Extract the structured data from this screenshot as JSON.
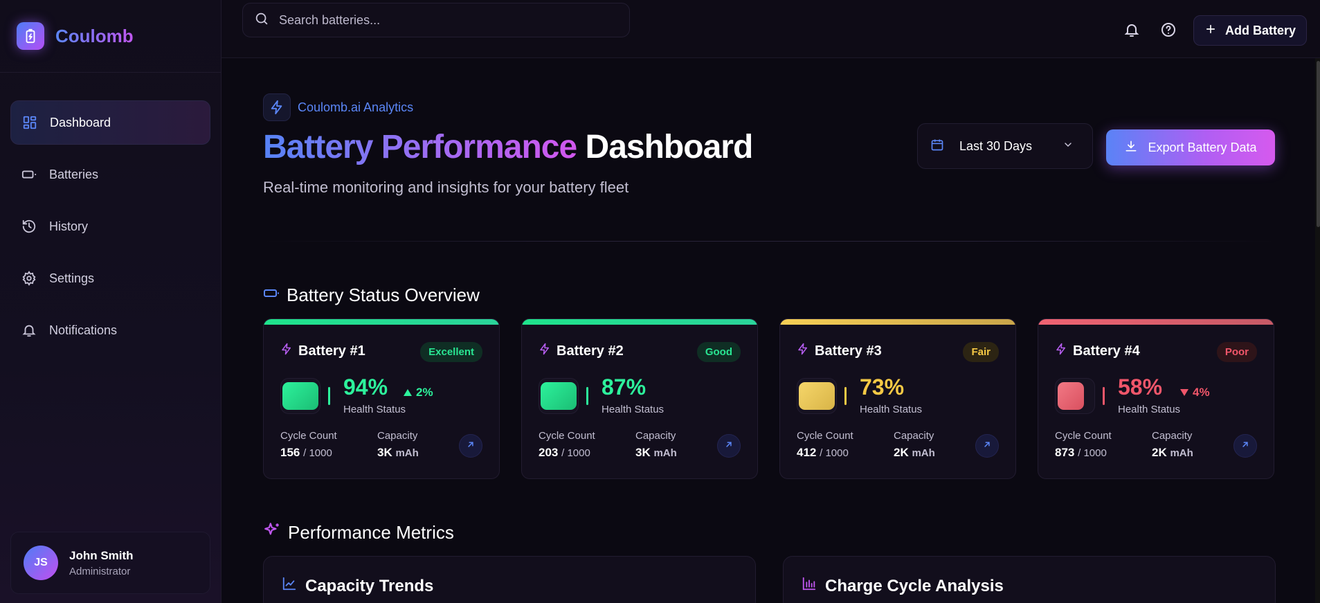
{
  "brand": {
    "name": "Coulomb"
  },
  "search": {
    "placeholder": "Search batteries..."
  },
  "topbar": {
    "add_label": "Add Battery"
  },
  "nav": [
    {
      "label": "Dashboard",
      "icon": "dashboard-icon",
      "active": true
    },
    {
      "label": "Batteries",
      "icon": "battery-icon"
    },
    {
      "label": "History",
      "icon": "history-icon"
    },
    {
      "label": "Settings",
      "icon": "gear-icon"
    },
    {
      "label": "Notifications",
      "icon": "bell-icon"
    }
  ],
  "user": {
    "initials": "JS",
    "name": "John Smith",
    "role": "Administrator"
  },
  "header": {
    "pill": "Coulomb.ai Analytics",
    "title_gradient": "Battery Performance",
    "title_plain": "Dashboard",
    "subtitle": "Real-time monitoring and insights for your battery fleet",
    "range": "Last 30 Days",
    "export_label": "Export Battery Data"
  },
  "status_section": {
    "title": "Battery Status Overview"
  },
  "batteries": [
    {
      "name": "Battery #1",
      "badge": "Excellent",
      "health": "94%",
      "delta": "2%",
      "delta_dir": "up",
      "health_label": "Health Status",
      "cycle_label": "Cycle Count",
      "cycle": "156",
      "cycle_max": "/ 1000",
      "capacity_label": "Capacity",
      "capacity": "3K",
      "capacity_unit": "mAh",
      "color": "#22e38a"
    },
    {
      "name": "Battery #2",
      "badge": "Good",
      "health": "87%",
      "delta": "",
      "delta_dir": "",
      "health_label": "Health Status",
      "cycle_label": "Cycle Count",
      "cycle": "203",
      "cycle_max": "/ 1000",
      "capacity_label": "Capacity",
      "capacity": "3K",
      "capacity_unit": "mAh",
      "color": "#22e38a"
    },
    {
      "name": "Battery #3",
      "badge": "Fair",
      "health": "73%",
      "delta": "",
      "delta_dir": "",
      "health_label": "Health Status",
      "cycle_label": "Cycle Count",
      "cycle": "412",
      "cycle_max": "/ 1000",
      "capacity_label": "Capacity",
      "capacity": "2K",
      "capacity_unit": "mAh",
      "color": "#f2c94c"
    },
    {
      "name": "Battery #4",
      "badge": "Poor",
      "health": "58%",
      "delta": "4%",
      "delta_dir": "down",
      "health_label": "Health Status",
      "cycle_label": "Cycle Count",
      "cycle": "873",
      "cycle_max": "/ 1000",
      "capacity_label": "Capacity",
      "capacity": "2K",
      "capacity_unit": "mAh",
      "color": "#ef5b6b"
    }
  ],
  "metrics_section": {
    "title": "Performance Metrics"
  },
  "panels": [
    {
      "title": "Capacity Trends"
    },
    {
      "title": "Charge Cycle Analysis"
    }
  ]
}
